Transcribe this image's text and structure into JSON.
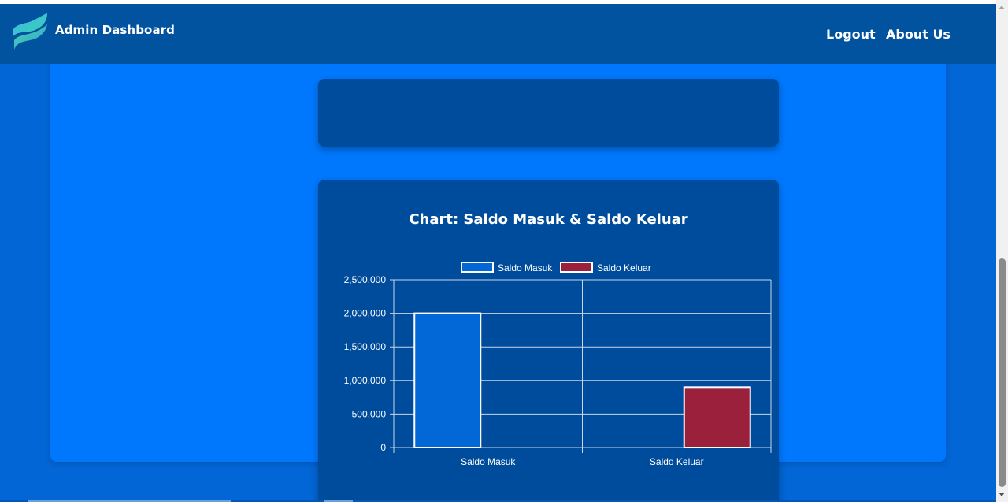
{
  "navbar": {
    "brand_title": "Admin Dashboard",
    "links": [
      "Logout",
      "About Us"
    ]
  },
  "colors": {
    "navbar": "#01529f",
    "panel": "#0078fe",
    "card": "#004c9c",
    "series_masuk": "#0368d7",
    "series_keluar": "#9b203c"
  },
  "icons": {
    "brand": "wave-logo-icon"
  },
  "chart": {
    "title": "Chart: Saldo Masuk & Saldo Keluar"
  },
  "chart_data": {
    "type": "bar",
    "title": "Chart: Saldo Masuk & Saldo Keluar",
    "categories": [
      "Saldo Masuk",
      "Saldo Keluar"
    ],
    "series": [
      {
        "name": "Saldo Masuk",
        "values": [
          2000000,
          null
        ],
        "color": "#0368d7"
      },
      {
        "name": "Saldo Keluar",
        "values": [
          null,
          900000
        ],
        "color": "#9b203c"
      }
    ],
    "y_ticks": [
      "0",
      "500,000",
      "1,000,000",
      "1,500,000",
      "2,000,000",
      "2,500,000"
    ],
    "ylim": [
      0,
      2500000
    ],
    "legend": "top-center",
    "grid": true
  }
}
